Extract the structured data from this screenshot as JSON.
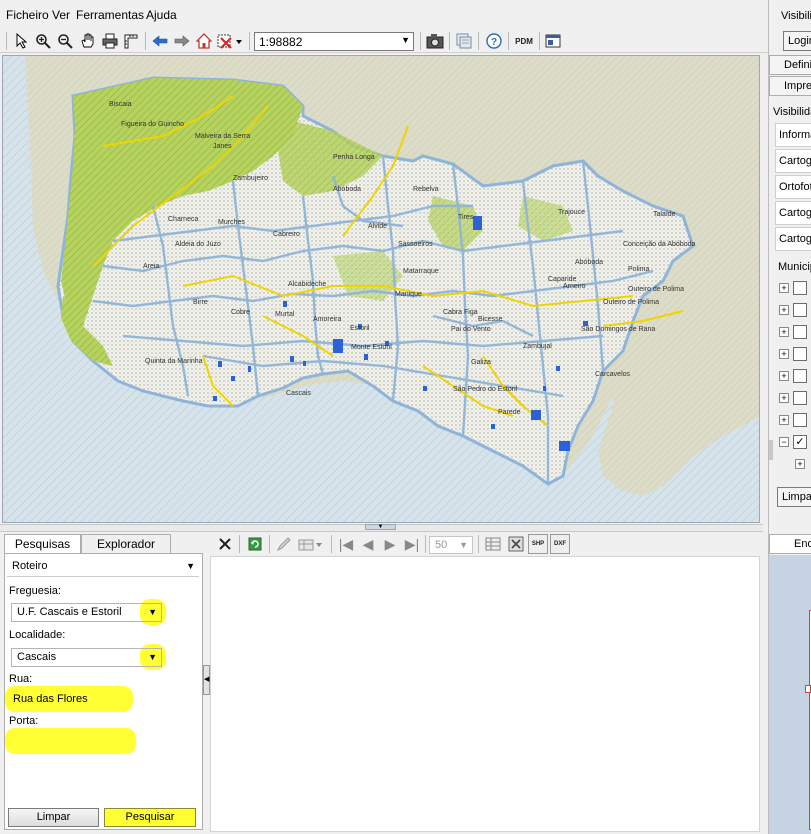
{
  "menu": {
    "items": [
      "Ficheiro",
      "Ver",
      "Ferramentas",
      "Ajuda"
    ]
  },
  "toolbar": {
    "scale": "1:98882",
    "icons": [
      "select-arrow-icon",
      "zoom-in-icon",
      "zoom-out-icon",
      "pan-hand-icon",
      "print-icon",
      "measure-icon",
      "back-arrow-icon",
      "forward-arrow-icon",
      "home-icon",
      "clear-selection-icon",
      "scale-combo",
      "camera-icon",
      "layers-icon",
      "help-icon",
      "pdm-icon",
      "window-icon"
    ],
    "pdm_label": "PDM"
  },
  "map": {
    "labels": [
      "Biscaia",
      "Figueira do Guincho",
      "Malveira da Serra",
      "Janes",
      "Zambujeiro",
      "Penha Longa",
      "Abóboda",
      "Charneca",
      "Murches",
      "Cabreiro",
      "Aldeia do Juzo",
      "Areia",
      "Birre",
      "Cobre",
      "Quinta da Marinha",
      "Cascais",
      "Alcabideche",
      "Amoreira",
      "Estoril",
      "Monte Estoril",
      "Trajouce",
      "Talaíde",
      "Conceição da Abóboda",
      "Abóboda",
      "Polima",
      "Outeiro de Polima",
      "Caparide",
      "São Domingos de Rana",
      "Zambujal",
      "Carcavelos",
      "Parede",
      "São Pedro do Estoril",
      "Galiza",
      "Tires",
      "Rebelva",
      "Sassoeiros",
      "Matarraque",
      "Cabra Figa",
      "Alvide",
      "Bicesse",
      "Manique",
      "Pai do Vento",
      "Outeiro de Polima",
      "Arneiro",
      "Murtal"
    ]
  },
  "search": {
    "tabs": [
      "Pesquisas",
      "Explorador"
    ],
    "type": "Roteiro",
    "freguesia_label": "Freguesia:",
    "freguesia_value": "U.F. Cascais e Estoril",
    "localidade_label": "Localidade:",
    "localidade_value": "Cascais",
    "rua_label": "Rua:",
    "rua_value": "Rua das Flores",
    "porta_label": "Porta:",
    "porta_value": "",
    "clear_button": "Limpar",
    "search_button": "Pesquisar",
    "highlight_color": "#ffff33"
  },
  "results": {
    "page_size": "50",
    "icons": [
      "close-icon",
      "refresh-icon",
      "edit-icon",
      "table-tools-icon",
      "first-page-icon",
      "prev-page-icon",
      "next-page-icon",
      "last-page-icon",
      "grid-icon",
      "excel-icon",
      "shp-icon",
      "dxf-icon"
    ],
    "shp_label": "SHP",
    "dxf_label": "DXF"
  },
  "right_panel": {
    "title": "Visibilic",
    "login": "Login",
    "buttons": [
      "Defini",
      "Impre"
    ],
    "visibility_label": "Visibilida",
    "rows": [
      "Informa",
      "Cartog",
      "Ortofot",
      "Cartog",
      "Cartog"
    ],
    "municipio_label": "Municip",
    "clear_button": "Limpar",
    "bottom_tab": "Enq"
  }
}
